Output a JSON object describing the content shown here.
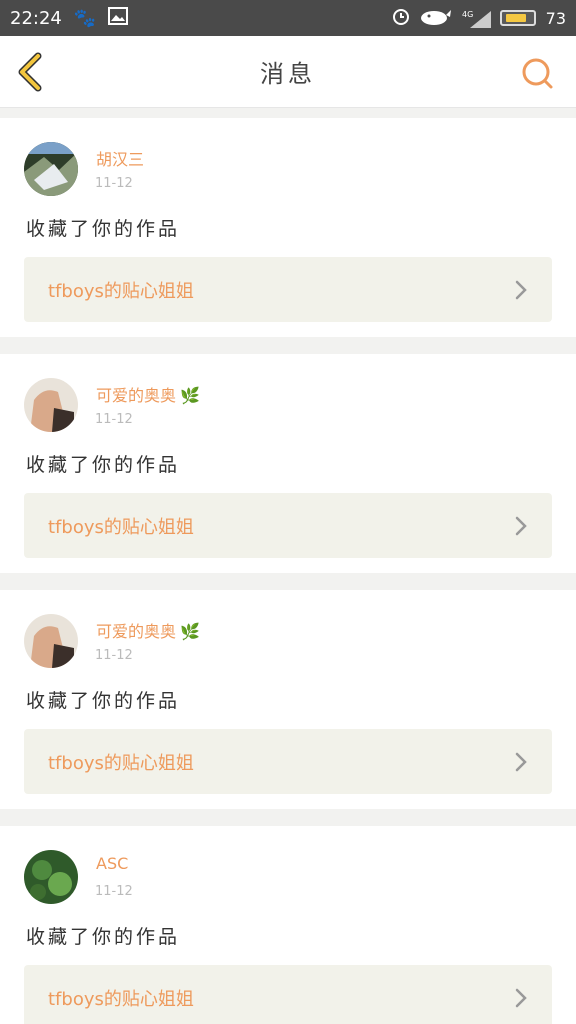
{
  "status_bar": {
    "time": "22:24",
    "battery": "73",
    "network": "4G"
  },
  "nav": {
    "title": "消息"
  },
  "colors": {
    "accent": "#ee9a5c",
    "back_arrow": "#f3c63e",
    "work_bg": "#f2f2ea"
  },
  "messages": [
    {
      "user": "胡汉三",
      "date": "11-12",
      "action": "收藏了你的作品",
      "work": "tfboys的贴心姐姐",
      "leaf": ""
    },
    {
      "user": "可爱的奥奥",
      "date": "11-12",
      "action": "收藏了你的作品",
      "work": "tfboys的贴心姐姐",
      "leaf": "🌿"
    },
    {
      "user": "可爱的奥奥",
      "date": "11-12",
      "action": "收藏了你的作品",
      "work": "tfboys的贴心姐姐",
      "leaf": "🌿"
    },
    {
      "user": "ASC",
      "date": "11-12",
      "action": "收藏了你的作品",
      "work": "tfboys的贴心姐姐",
      "leaf": ""
    }
  ]
}
